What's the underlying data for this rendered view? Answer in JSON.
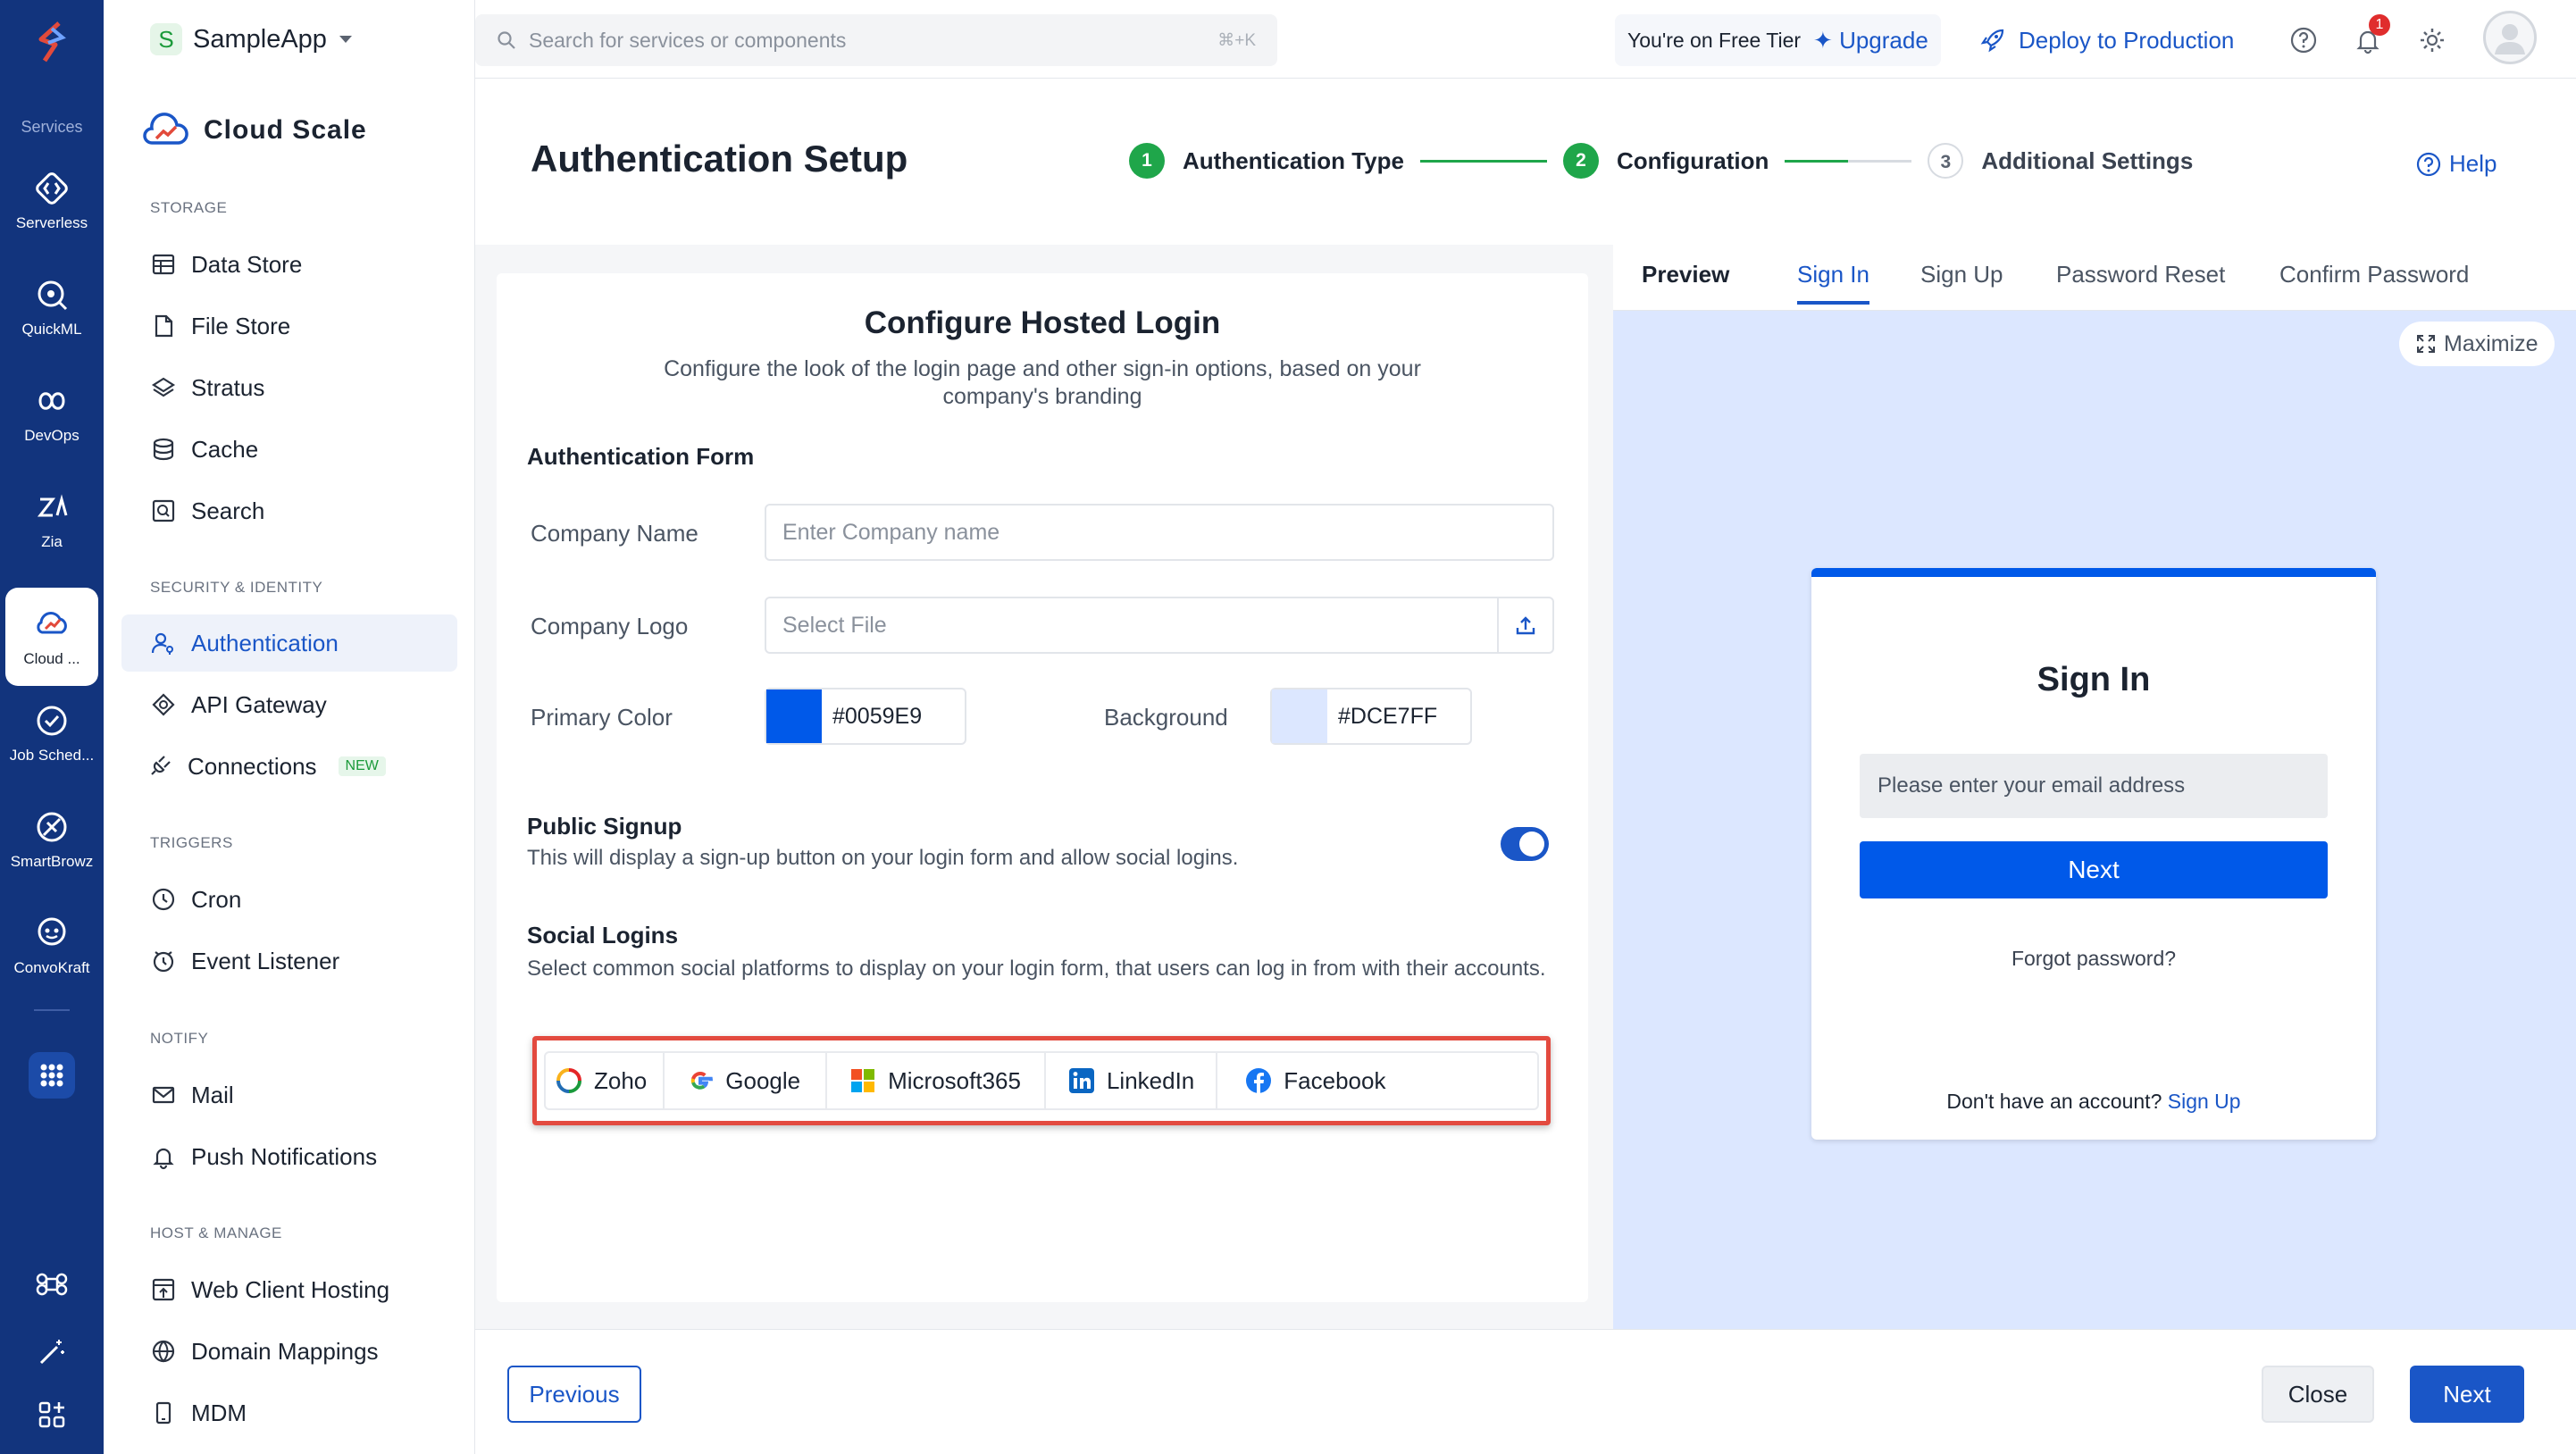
{
  "rail": {
    "services_label": "Services",
    "items": [
      {
        "label": "Serverless",
        "icon": "serverless-icon"
      },
      {
        "label": "QuickML",
        "icon": "quickml-icon"
      },
      {
        "label": "DevOps",
        "icon": "devops-icon"
      },
      {
        "label": "Zia",
        "icon": "zia-icon"
      },
      {
        "label": "Cloud ...",
        "icon": "cloud-scale-icon",
        "active": true
      },
      {
        "label": "Job Sched...",
        "icon": "job-scheduling-icon"
      },
      {
        "label": "SmartBrowz",
        "icon": "smartbrowz-icon"
      },
      {
        "label": "ConvoKraft",
        "icon": "convokraft-icon"
      }
    ]
  },
  "app": {
    "badge": "S",
    "name": "SampleApp"
  },
  "sidebar": {
    "title": "Cloud Scale",
    "sections": [
      {
        "label": "STORAGE",
        "items": [
          "Data Store",
          "File Store",
          "Stratus",
          "Cache",
          "Search"
        ]
      },
      {
        "label": "SECURITY & IDENTITY",
        "items": [
          "Authentication",
          "API Gateway",
          "Connections"
        ],
        "new_badge": "NEW"
      },
      {
        "label": "TRIGGERS",
        "items": [
          "Cron",
          "Event Listener"
        ]
      },
      {
        "label": "NOTIFY",
        "items": [
          "Mail",
          "Push Notifications"
        ]
      },
      {
        "label": "HOST & MANAGE",
        "items": [
          "Web Client Hosting",
          "Domain Mappings",
          "MDM"
        ]
      }
    ]
  },
  "topbar": {
    "search_placeholder": "Search for services or components",
    "search_shortcut": "⌘+K",
    "tier_text": "You're on Free Tier",
    "upgrade": "Upgrade",
    "deploy": "Deploy to Production",
    "notifications_count": "1"
  },
  "header": {
    "title": "Authentication Setup",
    "steps": [
      {
        "num": "1",
        "label": "Authentication Type"
      },
      {
        "num": "2",
        "label": "Configuration"
      },
      {
        "num": "3",
        "label": "Additional Settings"
      }
    ],
    "help": "Help"
  },
  "config": {
    "title": "Configure Hosted Login",
    "subtitle": "Configure the look of the login page and other sign-in options, based on your company's branding",
    "form_heading": "Authentication Form",
    "company_name_label": "Company Name",
    "company_name_placeholder": "Enter Company name",
    "company_logo_label": "Company Logo",
    "company_logo_placeholder": "Select File",
    "primary_color_label": "Primary Color",
    "primary_color": "#0059E9",
    "background_label": "Background",
    "background_color": "#DCE7FF",
    "public_signup_heading": "Public Signup",
    "public_signup_desc": "This will display a sign-up button on your login form and allow social logins.",
    "public_signup_enabled": true,
    "social_heading": "Social Logins",
    "social_desc": "Select common social platforms to display on your login form, that users can log in from with their accounts.",
    "social_providers": [
      "Zoho",
      "Google",
      "Microsoft365",
      "LinkedIn",
      "Facebook"
    ]
  },
  "preview": {
    "label": "Preview",
    "tabs": [
      "Sign In",
      "Sign Up",
      "Password Reset",
      "Confirm Password"
    ],
    "active_tab": "Sign In",
    "maximize": "Maximize",
    "login": {
      "title": "Sign In",
      "email_placeholder": "Please enter your email address",
      "next": "Next",
      "forgot": "Forgot password?",
      "no_account": "Don't have an account?",
      "signup_link": "Sign Up"
    }
  },
  "footer": {
    "previous": "Previous",
    "close": "Close",
    "next": "Next"
  }
}
